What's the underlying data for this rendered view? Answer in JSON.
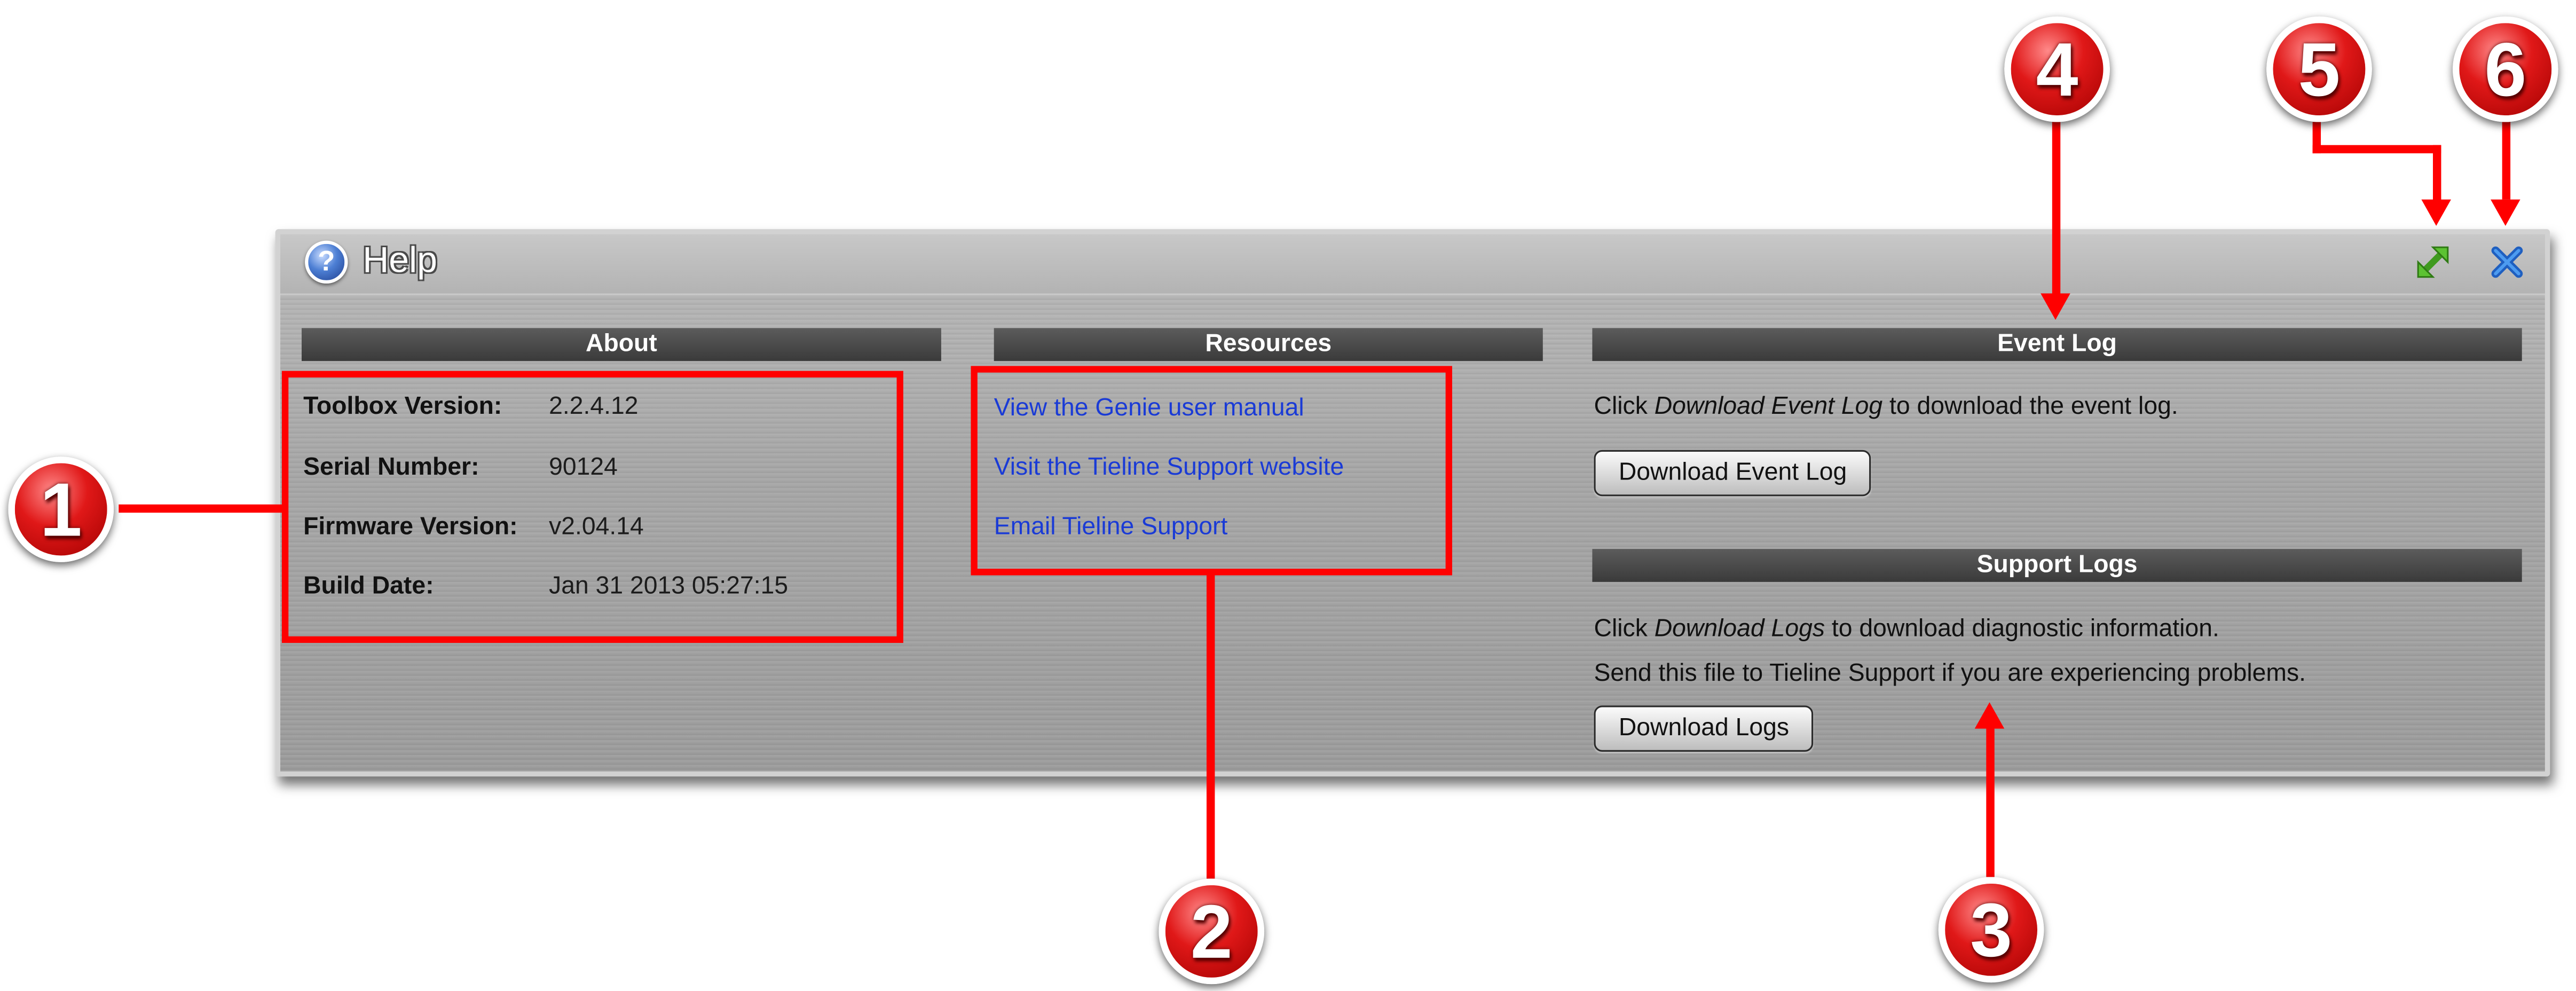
{
  "window": {
    "title": "Help",
    "icon": "help-question-icon"
  },
  "title_buttons": {
    "expand": "expand-icon",
    "close": "close-icon"
  },
  "about": {
    "header": "About",
    "rows": [
      {
        "label": "Toolbox Version:",
        "value": "2.2.4.12"
      },
      {
        "label": "Serial Number:",
        "value": "90124"
      },
      {
        "label": "Firmware Version:",
        "value": "v2.04.14"
      },
      {
        "label": "Build Date:",
        "value": "Jan 31 2013 05:27:15"
      }
    ]
  },
  "resources": {
    "header": "Resources",
    "links": [
      "View the Genie user manual",
      "Visit the Tieline Support website",
      "Email Tieline Support"
    ]
  },
  "event_log": {
    "header": "Event Log",
    "text_prefix": "Click ",
    "text_emphasis": "Download Event Log",
    "text_suffix": " to download the event log.",
    "button_label": "Download Event Log"
  },
  "support_logs": {
    "header": "Support Logs",
    "text_prefix": "Click ",
    "text_emphasis": "Download Logs",
    "text_suffix": " to download diagnostic information.",
    "text2": "Send this file to Tieline Support if you are experiencing problems.",
    "button_label": "Download Logs"
  },
  "callouts": [
    "1",
    "2",
    "3",
    "4",
    "5",
    "6"
  ],
  "colors": {
    "annotation": "#ff0000",
    "link": "#1a3bd6",
    "header_bar": "#444444",
    "expand_icon": "#4caf2a",
    "close_icon": "#1f6fd1"
  }
}
